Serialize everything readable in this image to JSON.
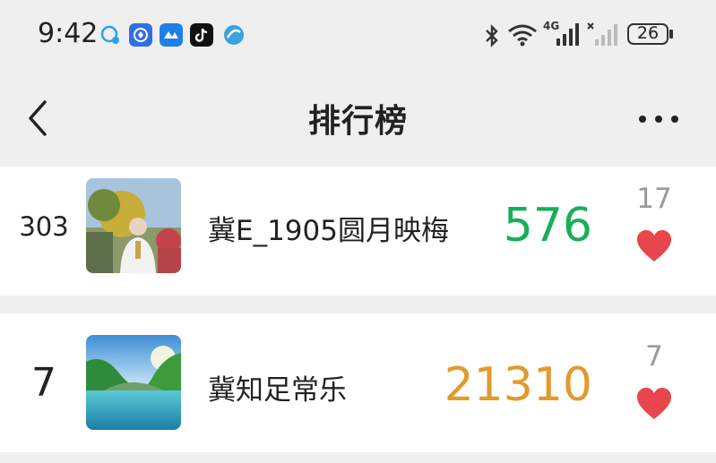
{
  "status_bar": {
    "time": "9:42",
    "battery": "26",
    "network": "4G",
    "app_icons": [
      "message-icon",
      "ding-icon",
      "feishu-icon",
      "tiktok-icon",
      "browser-icon"
    ]
  },
  "nav": {
    "title": "排行榜"
  },
  "rankings": [
    {
      "rank": "303",
      "name": "冀E_1905圆月映梅",
      "score": "576",
      "score_color": "#1aad5b",
      "likes": "17",
      "avatar": "elderly-woman-photo"
    },
    {
      "rank": "7",
      "name": "冀知足常乐",
      "score": "21310",
      "score_color": "#e39a2d",
      "likes": "7",
      "avatar": "lake-landscape-photo"
    }
  ],
  "colors": {
    "heart": "#e8454c",
    "background": "#efefef"
  }
}
